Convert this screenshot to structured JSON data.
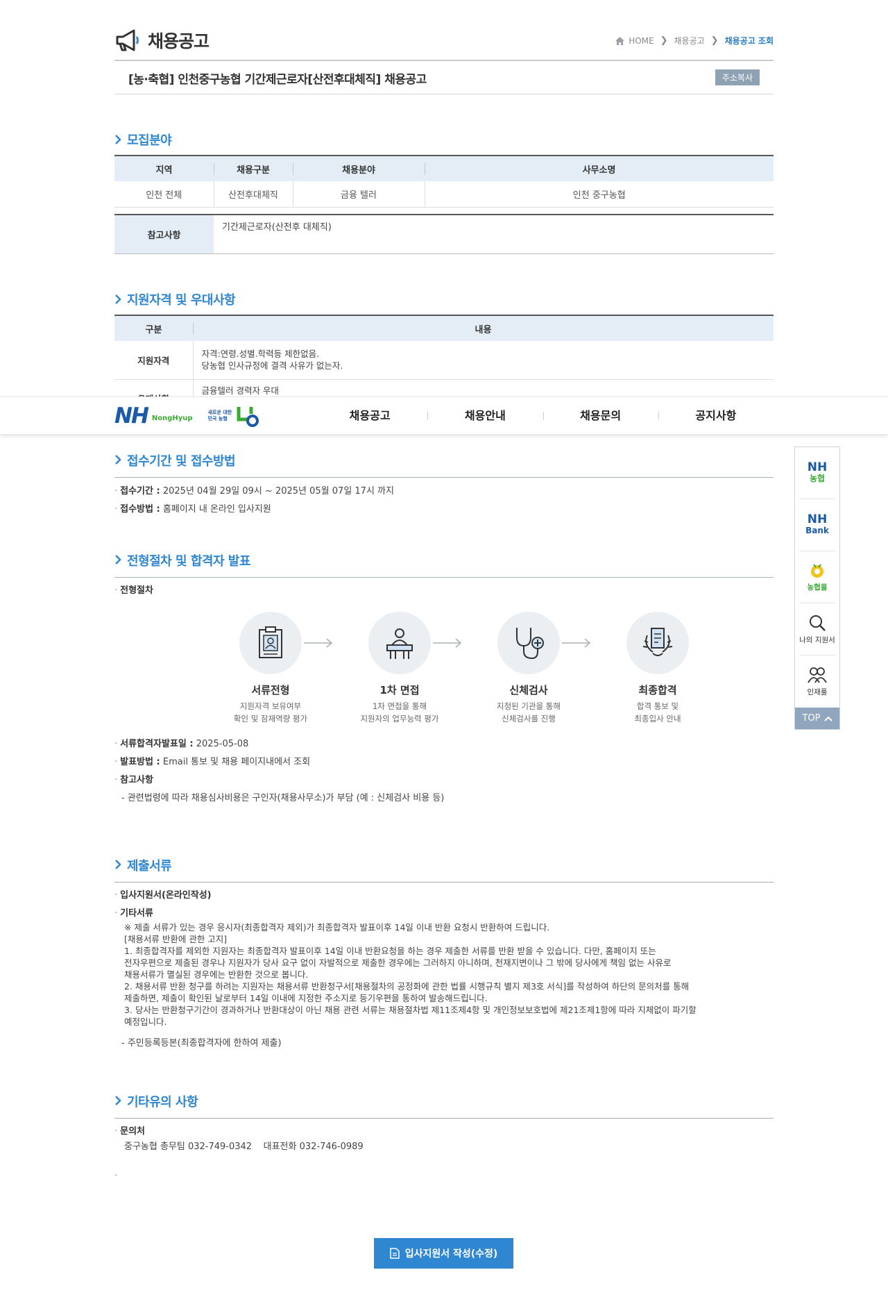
{
  "header": {
    "title": "채용공고",
    "breadcrumb": [
      "HOME",
      "채용공고",
      "채용공고 조회"
    ]
  },
  "notice": {
    "title": "[농·축협] 인천중구농협 기간제근로자[산전후대체직] 채용공고",
    "copy_label": "주소복사"
  },
  "recruit": {
    "heading": "모집분야",
    "columns": [
      "지역",
      "채용구분",
      "채용분야",
      "사무소명"
    ],
    "row": [
      "인천 전체",
      "산전후대체직",
      "금융 텔러",
      "인천 중구농협"
    ],
    "note_label": "참고사항",
    "note_value": "기간제근로자(산전후 대체직)"
  },
  "qualification": {
    "heading": "지원자격 및 우대사항",
    "columns": [
      "구분",
      "내용"
    ],
    "rows": [
      {
        "label": "지원자격",
        "lines": [
          "자격:연령.성별.학력등 제한없음.",
          "당농협 인사규정에 결격 사유가 없는자."
        ]
      },
      {
        "label": "우대사항",
        "lines": [
          "금융텔러 경력자 우대"
        ]
      }
    ]
  },
  "gnb": {
    "brand": "NH",
    "brand_sub": "NongHyup",
    "slogan": "새로운 대한민국 농협",
    "menu": [
      "채용공고",
      "채용안내",
      "채용문의",
      "공지사항"
    ]
  },
  "reception": {
    "heading": "접수기간 및 접수방법",
    "items": [
      {
        "label": "접수기간 :",
        "value": "2025년 04월 29일 09시 ~ 2025년 05월 07일 17시 까지"
      },
      {
        "label": "접수방법 :",
        "value": "홈페이지 내 온라인 입사지원"
      }
    ]
  },
  "process": {
    "heading": "전형절차 및 합격자 발표",
    "sub": "전형절차",
    "steps": [
      {
        "name": "서류전형",
        "desc1": "지원자격 보유여부",
        "desc2": "확인 및 잠재역량 평가"
      },
      {
        "name": "1차 면접",
        "desc1": "1차 면접을 통해",
        "desc2": "지원자의 업무능력 평가"
      },
      {
        "name": "신체검사",
        "desc1": "지정된 기관을 통해",
        "desc2": "신체검사를 진행"
      },
      {
        "name": "최종합격",
        "desc1": "합격 통보 및",
        "desc2": "최종입사 안내"
      }
    ],
    "items": [
      {
        "label": "서류합격자발표일 :",
        "value": "2025-05-08"
      },
      {
        "label": "발표방법 :",
        "value": "Email 통보 및 채용 페이지내에서 조회"
      },
      {
        "label": "참고사항",
        "value": ""
      }
    ],
    "note": "- 관련법령에 따라 채용심사비용은 구인자(채용사무소)가 부담 (예 : 신체검사 비용 등)"
  },
  "documents": {
    "heading": "제출서류",
    "item1": "입사지원서(온라인작성)",
    "item2": "기타서류",
    "lines": [
      "※ 제출 서류가 있는 경우 응시자(최종합격자 제외)가 최종합격자 발표이후 14일 이내 반환 요청시 반환하여 드립니다.",
      "[채용서류 반환에 관한 고지]",
      " 1. 최종합격자를 제외한 지원자는 최종합격자 발표이후 14일 이내 반환요청을 하는 경우 제출한 서류를 반환 받을 수 있습니다. 다만, 홈페이지 또는",
      "전자우편으로 제출된 경우나 지원자가 당사 요구 없이 자발적으로 제출한 경우에는 그러하지 아니하며, 천재지변이나 그 밖에 당사에게 책임 없는 사유로",
      "채용서류가 멸실된 경우에는 반환한 것으로 봅니다.",
      " 2. 채용서류 반환 청구를 하려는 지원자는 채용서류 반환청구서[채용절차의 공정화에 관한 법률 시행규칙 별지 제3호 서식]를 작성하여 하단의 문의처를 통해",
      "제출하면, 제출이 확인된 날로부터 14일 이내에 지정한 주소지로 등기우편을 통하여 발송해드립니다.",
      " 3. 당사는 반환청구기간이 경과하거나 반환대상이 아닌 채용 관련 서류는 채용절차법 제11조제4항 및 개인정보보호법에 제21조제1항에 따라 지체없이 파기할",
      "예정입니다."
    ],
    "last": "- 주민등록등본(최종합격자에 한하여 제출)"
  },
  "etc": {
    "heading": "기타유의 사항",
    "label": "문의처",
    "contact": "중구농협 총무팀 032-749-0342    대표전화 032-746-0989",
    "dot": "."
  },
  "quick": {
    "items": [
      {
        "top": "NH",
        "bottom": "농협"
      },
      {
        "top": "NH",
        "bottom": "Bank"
      },
      {
        "label": "농협몰"
      },
      {
        "label": "나의 지원서"
      },
      {
        "label": "인재풀"
      }
    ],
    "top_label": "TOP"
  },
  "apply_label": "입사지원서 작성(수정)",
  "colors": {
    "accent": "#2f86d1",
    "brand": "#1b5aa8",
    "green": "#3aaa35"
  }
}
